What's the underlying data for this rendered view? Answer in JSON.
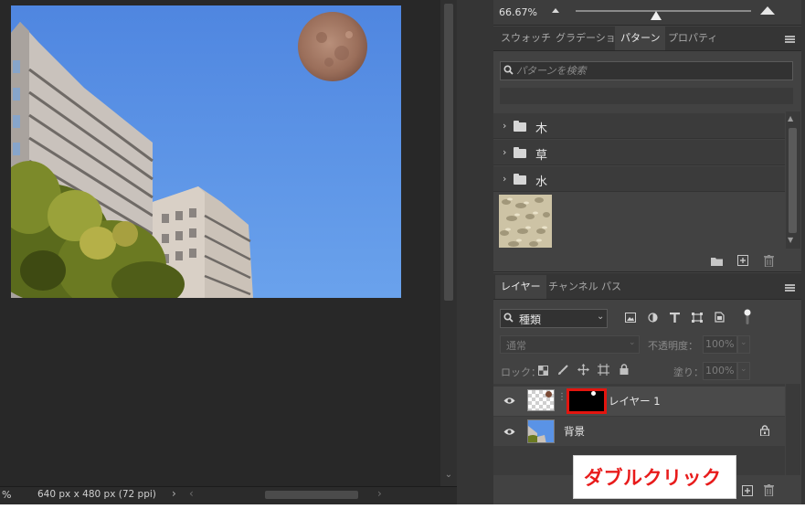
{
  "navigator": {
    "zoom": "66.67%"
  },
  "patterns_panel": {
    "tabs": [
      {
        "label": "スウォッチ",
        "active": false
      },
      {
        "label": "グラデーション",
        "active": false
      },
      {
        "label": "パターン",
        "active": true
      },
      {
        "label": "プロパティ",
        "active": false
      }
    ],
    "search_placeholder": "パターンを検索",
    "folders": [
      {
        "name": "木"
      },
      {
        "name": "草"
      },
      {
        "name": "水"
      }
    ]
  },
  "layers_panel": {
    "tabs": [
      {
        "label": "レイヤー",
        "active": true
      },
      {
        "label": "チャンネル",
        "active": false
      },
      {
        "label": "パス",
        "active": false
      }
    ],
    "filter": {
      "label": "種類"
    },
    "blend_mode": "通常",
    "opacity_label": "不透明度：",
    "opacity_value": "100%",
    "lock_label": "ロック：",
    "fill_label": "塗り：",
    "fill_value": "100%",
    "layers": [
      {
        "name": "レイヤー 1",
        "selected": true,
        "has_mask": true
      },
      {
        "name": "背景",
        "selected": false,
        "locked": true
      }
    ]
  },
  "status_bar": {
    "zoom": "%",
    "document_size": "640 px x 480 px (72 ppi)"
  },
  "annotation": {
    "text": "ダブルクリック",
    "color": "#e81b1b"
  },
  "colors": {
    "panel_bg": "#424242",
    "canvas_bg": "#282828",
    "highlight_red": "#e3150f",
    "sky_blue": "#5a93e6"
  }
}
